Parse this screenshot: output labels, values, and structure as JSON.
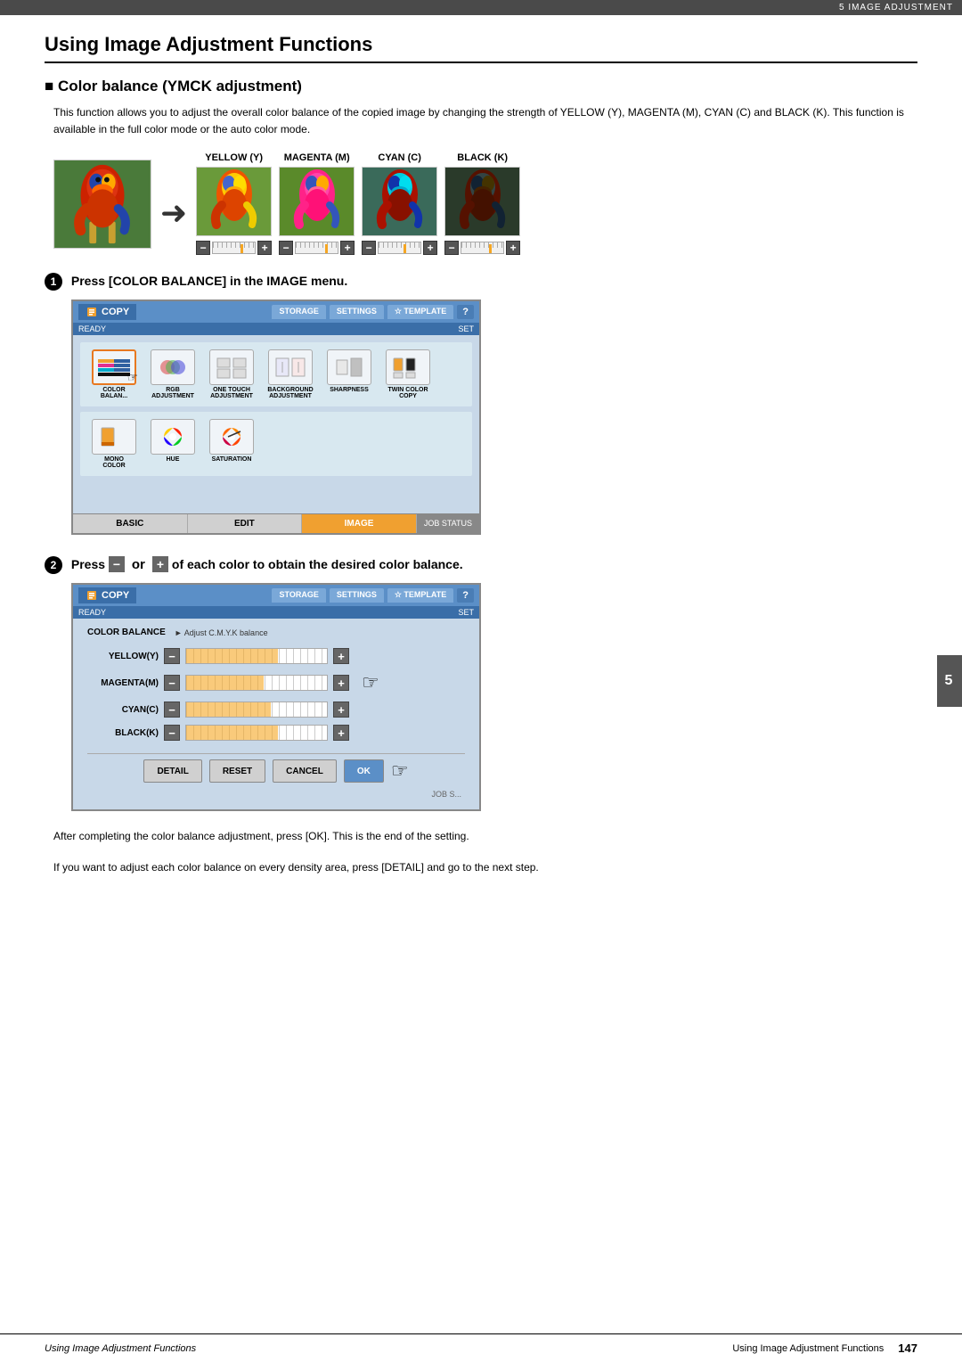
{
  "topbar": {
    "label": "5 IMAGE ADJUSTMENT"
  },
  "page_title": "Using Image Adjustment Functions",
  "section_heading": "Color balance (YMCK adjustment)",
  "section_desc": "This function allows you to adjust the overall color balance of the copied image by changing the strength of YELLOW (Y),\nMAGENTA (M), CYAN (C) and BLACK (K). This function is available in the full color mode or the auto color mode.",
  "color_labels": {
    "yellow": "YELLOW (Y)",
    "magenta": "MAGENTA (M)",
    "cyan": "CYAN (C)",
    "black": "BLACK (K)"
  },
  "step1": {
    "number": "1",
    "label": "Press [COLOR BALANCE] in the IMAGE menu.",
    "screen": {
      "title": "COPY",
      "status": "READY",
      "set_label": "SET",
      "tabs": [
        "STORAGE",
        "SETTINGS",
        "TEMPLATE"
      ],
      "icons": [
        {
          "label": "COLOR\nBALAN...",
          "active": true
        },
        {
          "label": "RGB\nADJUSTMENT"
        },
        {
          "label": "ONE TOUCH\nADJUSTMENT"
        },
        {
          "label": "BACKGROUND\nADJUSTMENT"
        },
        {
          "label": "SHARPNESS"
        },
        {
          "label": "TWIN COLOR\nCOPY"
        }
      ],
      "icons2": [
        {
          "label": "MONO\nCOLOR"
        },
        {
          "label": "HUE"
        },
        {
          "label": "SATURATION"
        }
      ],
      "bottom_tabs": [
        "BASIC",
        "EDIT",
        "IMAGE"
      ],
      "job_status": "JOB STATUS"
    }
  },
  "step2": {
    "number": "2",
    "label_before_minus": "Press",
    "or_text": "or",
    "label_after_plus": "of each color to obtain the desired color balance.",
    "screen": {
      "title": "COPY",
      "status": "READY",
      "set_label": "SET",
      "tabs": [
        "STORAGE",
        "SETTINGS",
        "TEMPLATE"
      ],
      "color_balance_title": "COLOR BALANCE",
      "color_balance_subtitle": "► Adjust C.M.Y.K balance",
      "rows": [
        {
          "label": "YELLOW(Y)"
        },
        {
          "label": "MAGENTA(M)"
        },
        {
          "label": "CYAN(C)"
        },
        {
          "label": "BLACK(K)"
        }
      ],
      "buttons": [
        "DETAIL",
        "RESET",
        "CANCEL",
        "OK"
      ],
      "job_status": "JOB S..."
    }
  },
  "note_texts": [
    "After completing the color balance adjustment, press [OK]. This is the end of the setting.",
    "If you want to adjust each color balance on every density area, press [DETAIL] and go to the next step."
  ],
  "footer": {
    "left": "Using Image Adjustment Functions",
    "page": "147"
  }
}
